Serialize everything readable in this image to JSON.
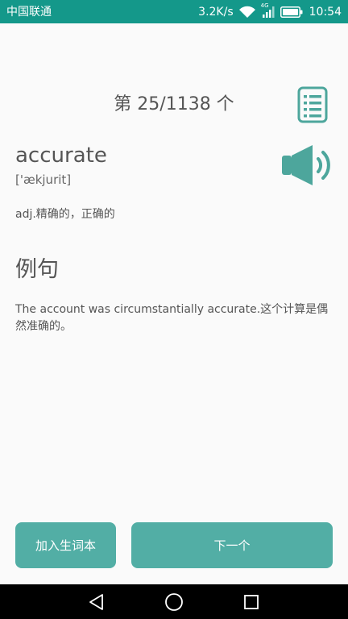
{
  "status_bar": {
    "carrier": "中国联通",
    "speed": "3.2K/s",
    "network_tag": "4G",
    "time": "10:54",
    "background_color": "#14988a",
    "icons": [
      "wifi-icon",
      "signal-icon",
      "battery-icon"
    ]
  },
  "header": {
    "counter": "第 25/1138 个",
    "list_icon": "word-list-icon"
  },
  "word": {
    "text": "accurate",
    "phonetic": "['ækjurit]",
    "meaning": "adj.精确的，正确的",
    "speaker_icon": "speaker-icon"
  },
  "example": {
    "heading": "例句",
    "sentence": "The account was circumstantially accurate.这个计算是偶然准确的。"
  },
  "buttons": {
    "add_to_vocab": "加入生词本",
    "next": "下一个",
    "color": "#52aea5"
  },
  "accent_color": "#4da69c",
  "nav_bar": {
    "icons": [
      "back-icon",
      "home-icon",
      "recent-apps-icon"
    ]
  }
}
